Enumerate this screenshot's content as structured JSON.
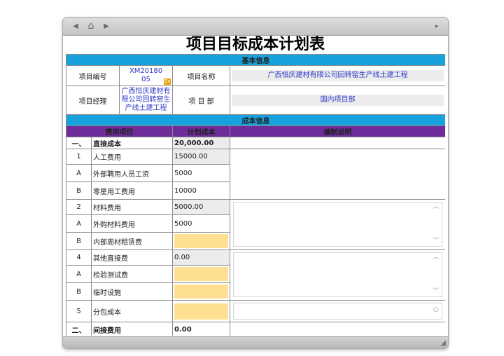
{
  "toolbar": {
    "back_icon": "◀",
    "home_icon": "⌂",
    "forward_icon": "▶",
    "menu_icon": "▸"
  },
  "sheet": {
    "title": "项目目标成本计划表",
    "section_basic": "基本信息",
    "project_no_label": "项目编号",
    "project_no_value": "XM2018005",
    "project_no_badge": "Ex",
    "project_name_label": "项目名称",
    "project_name_value": "广西恒庆建材有限公司回转窑生产线土建工程",
    "manager_label": "项目经理",
    "manager_value": "广西恒庆建材有限公司回转窑生产线土建工程",
    "dept_label": "项 目 部",
    "dept_value": "国内项目部",
    "section_cost": "成本信息",
    "headers": {
      "item": "费用项目",
      "plan": "计划成本",
      "note": "编制说明"
    },
    "rows": [
      {
        "no": "一、",
        "item": "直接成本",
        "plan": "20,000.00",
        "style": "bold"
      },
      {
        "no": "1",
        "item": "人工费用",
        "plan": "15000.00",
        "style": "gray"
      },
      {
        "no": "A",
        "item": "外部聘用人员工资",
        "plan": "5000",
        "style": "plain"
      },
      {
        "no": "B",
        "item": "零星用工费用",
        "plan": "10000",
        "style": "plain"
      },
      {
        "no": "2",
        "item": "材料费用",
        "plan": "5000.00",
        "style": "gray"
      },
      {
        "no": "A",
        "item": "外购材料费用",
        "plan": "5000",
        "style": "plain"
      },
      {
        "no": "B",
        "item": "内部周材租赁费",
        "plan": "",
        "style": "yellow"
      },
      {
        "no": "4",
        "item": "其他直接费",
        "plan": "0.00",
        "style": "gray"
      },
      {
        "no": "A",
        "item": "检验测试费",
        "plan": "",
        "style": "yellow"
      },
      {
        "no": "B",
        "item": "临时设施",
        "plan": "",
        "style": "yellow"
      },
      {
        "no": "5",
        "item": "分包成本",
        "plan": "",
        "style": "yellow"
      },
      {
        "no": "二、",
        "item": "间接费用",
        "plan": "0.00",
        "style": "bold"
      }
    ],
    "scroll_up": "︿",
    "scroll_down": "﹀"
  },
  "statusbar": {
    "grip_icon": "◢"
  }
}
